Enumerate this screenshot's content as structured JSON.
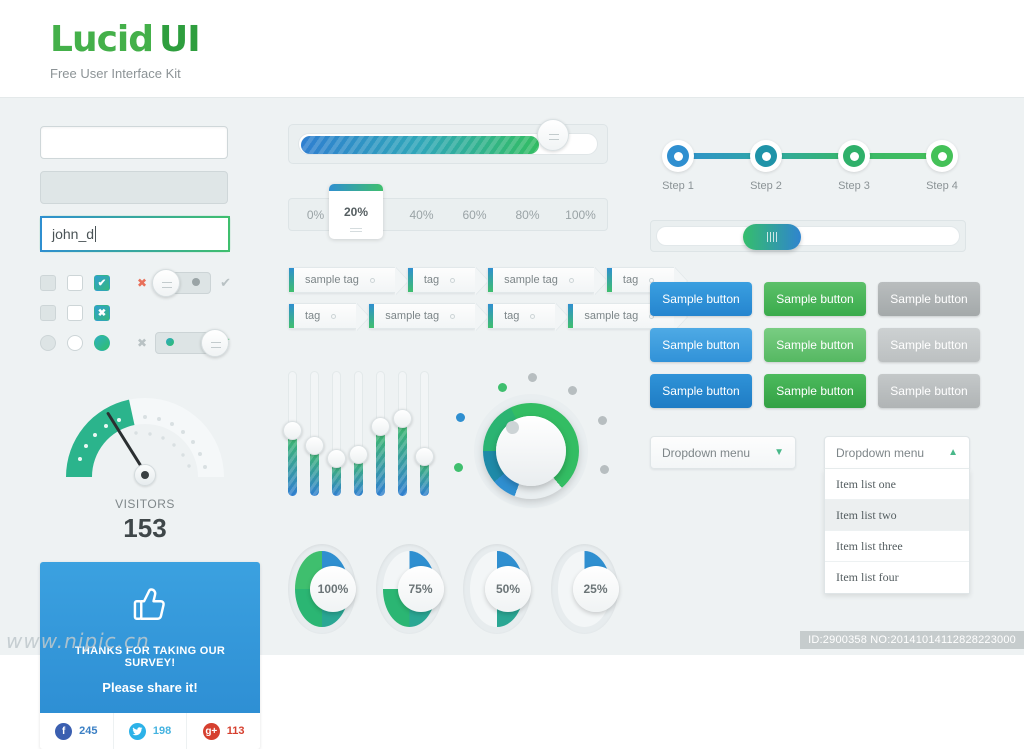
{
  "header": {
    "logo_lucid": "Lucid",
    "logo_ui": "UI",
    "tagline": "Free User Interface Kit"
  },
  "inputs": {
    "empty_placeholder": "",
    "disabled_placeholder": "",
    "focused_value": "john_d"
  },
  "controls": {
    "check_on_glyph": "✔",
    "check_x_glyph": "✖",
    "x_mark": "✖",
    "v_mark": "✔"
  },
  "gauge": {
    "label": "VISITORS",
    "value": "153"
  },
  "survey": {
    "icon": "thumbs-up-icon",
    "thumb_glyph": "👍",
    "title": "THANKS FOR TAKING OUR SURVEY!",
    "subtitle": "Please share it!",
    "shares": [
      {
        "network": "facebook",
        "glyph": "f",
        "count": "245"
      },
      {
        "network": "twitter",
        "glyph": "●",
        "count": "198"
      },
      {
        "network": "googleplus",
        "glyph": "g+",
        "count": "113"
      }
    ]
  },
  "progress": {
    "fill_percent": 80,
    "tabs": [
      "0%",
      "20%",
      "40%",
      "60%",
      "80%",
      "100%"
    ],
    "active_tab": "20%"
  },
  "tags": {
    "row1": [
      "sample tag",
      "tag",
      "sample tag",
      "tag"
    ],
    "row2": [
      "tag",
      "sample tag",
      "tag",
      "sample tag"
    ]
  },
  "sliders": {
    "values": [
      52,
      40,
      30,
      33,
      55,
      62,
      31
    ]
  },
  "knob": {
    "name": "rotary-knob"
  },
  "donuts": [
    {
      "label": "100%",
      "value": 100
    },
    {
      "label": "75%",
      "value": 75
    },
    {
      "label": "50%",
      "value": 50
    },
    {
      "label": "25%",
      "value": 25
    }
  ],
  "stepper": {
    "steps": [
      {
        "label": "Step 1",
        "color": "#2f8fd0"
      },
      {
        "label": "Step 2",
        "color": "#1f93a8"
      },
      {
        "label": "Step 3",
        "color": "#2fb06a"
      },
      {
        "label": "Step 4",
        "color": "#44c158"
      }
    ]
  },
  "buttons": {
    "rows": [
      [
        {
          "label": "Sample button",
          "style": "blue"
        },
        {
          "label": "Sample button",
          "style": "green"
        },
        {
          "label": "Sample button",
          "style": "gray"
        }
      ],
      [
        {
          "label": "Sample button",
          "style": "blue l"
        },
        {
          "label": "Sample button",
          "style": "green l"
        },
        {
          "label": "Sample button",
          "style": "gray l"
        }
      ],
      [
        {
          "label": "Sample button",
          "style": "blue d"
        },
        {
          "label": "Sample button",
          "style": "green d"
        },
        {
          "label": "Sample button",
          "style": "gray d"
        }
      ]
    ]
  },
  "dropdowns": {
    "closed": {
      "label": "Dropdown menu",
      "chevron": "▼"
    },
    "open": {
      "label": "Dropdown menu",
      "chevron": "▲",
      "items": [
        "Item list one",
        "Item list two",
        "Item list three",
        "Item list four"
      ],
      "highlighted_index": 1
    }
  },
  "watermarks": {
    "left": "www.nipic.cn",
    "right": "ID:2900358 NO:20141014112828223000"
  },
  "colors": {
    "blue": "#2f8fd0",
    "green": "#3fbf6e",
    "gray": "#b0b4b5",
    "background": "#eef2f3",
    "survey_blue": "#3ba1e0"
  }
}
